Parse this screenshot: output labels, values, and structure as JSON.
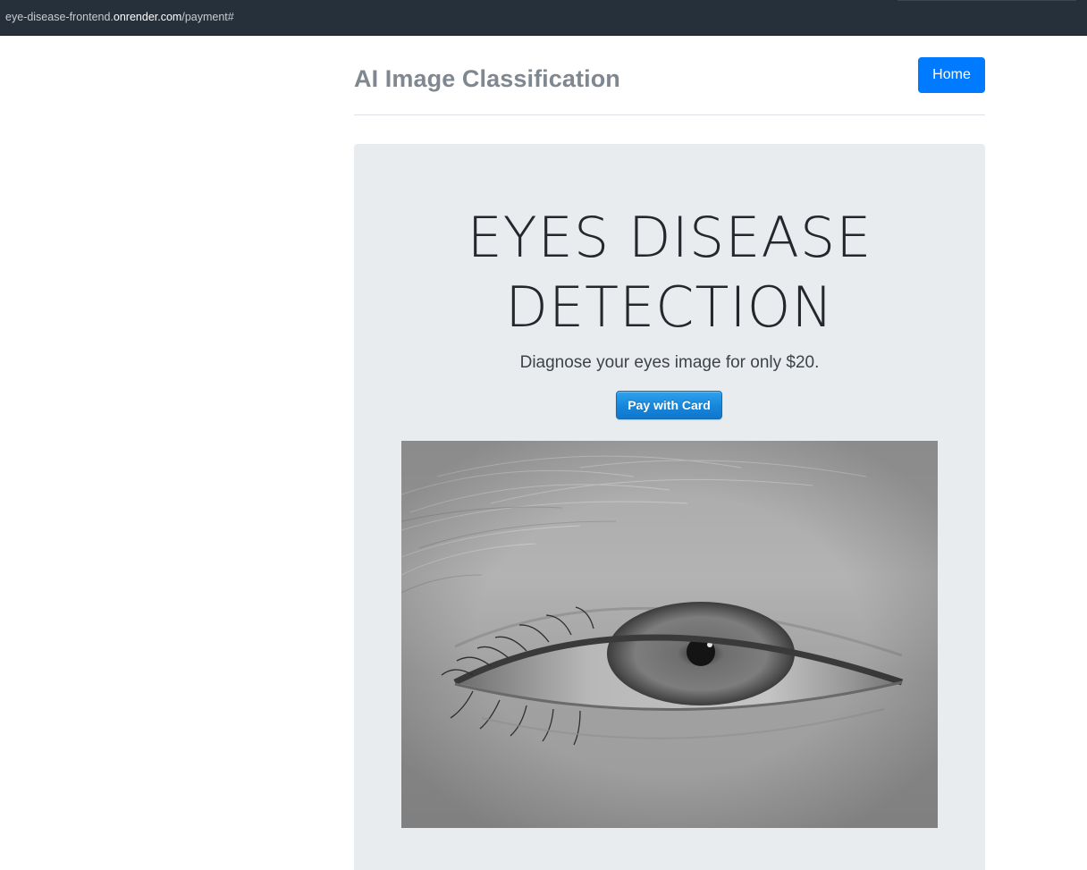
{
  "browser": {
    "url_prefix": "eye-disease-frontend.",
    "url_host": "onrender.com",
    "url_path": "/payment#"
  },
  "header": {
    "brand": "AI Image Classification",
    "home_label": "Home"
  },
  "hero": {
    "title_line1": "EYES DISEASE",
    "title_line2": "DETECTION",
    "lead": "Diagnose your eyes image for only $20.",
    "pay_label": "Pay with Card",
    "image_alt": "eye-photo"
  },
  "colors": {
    "primary": "#007bff",
    "jumbotron_bg": "#e9ecef",
    "brand_text": "#7f8790",
    "urlbar_bg": "#26303b"
  }
}
